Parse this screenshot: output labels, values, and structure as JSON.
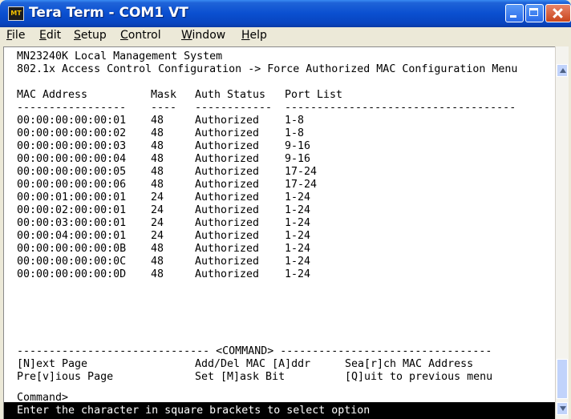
{
  "window": {
    "title": "Tera Term - COM1 VT",
    "app_icon_text": "MT"
  },
  "menu": [
    "File",
    "Edit",
    "Setup",
    "Control",
    "Window",
    "Help"
  ],
  "terminal": {
    "system_title": "MN23240K Local Management System",
    "breadcrumb": "802.1x Access Control Configuration -> Force Authorized MAC Configuration Menu",
    "headers": [
      "MAC Address",
      "Mask",
      "Auth Status",
      "Port List"
    ],
    "header_rules": [
      "-----------------",
      "----",
      "------------",
      "------------------------------------"
    ],
    "rows": [
      [
        "00:00:00:00:00:01",
        "48",
        "Authorized",
        "1-8"
      ],
      [
        "00:00:00:00:00:02",
        "48",
        "Authorized",
        "1-8"
      ],
      [
        "00:00:00:00:00:03",
        "48",
        "Authorized",
        "9-16"
      ],
      [
        "00:00:00:00:00:04",
        "48",
        "Authorized",
        "9-16"
      ],
      [
        "00:00:00:00:00:05",
        "48",
        "Authorized",
        "17-24"
      ],
      [
        "00:00:00:00:00:06",
        "48",
        "Authorized",
        "17-24"
      ],
      [
        "00:00:01:00:00:01",
        "24",
        "Authorized",
        "1-24"
      ],
      [
        "00:00:02:00:00:01",
        "24",
        "Authorized",
        "1-24"
      ],
      [
        "00:00:03:00:00:01",
        "24",
        "Authorized",
        "1-24"
      ],
      [
        "00:00:04:00:00:01",
        "24",
        "Authorized",
        "1-24"
      ],
      [
        "00:00:00:00:00:0B",
        "48",
        "Authorized",
        "1-24"
      ],
      [
        "00:00:00:00:00:0C",
        "48",
        "Authorized",
        "1-24"
      ],
      [
        "00:00:00:00:00:0D",
        "48",
        "Authorized",
        "1-24"
      ]
    ],
    "command_divider": "------------------------------ <COMMAND> ---------------------------------",
    "commands": [
      [
        "[N]ext Page",
        "Add/Del MAC [A]ddr",
        "Sea[r]ch MAC Address"
      ],
      [
        "Pre[v]ious Page",
        "Set [M]ask Bit",
        "[Q]uit to previous menu"
      ]
    ],
    "prompt": "Command>",
    "status": "Enter the character in square brackets to select option"
  },
  "colors": {
    "title_bar": "#0a4fd0",
    "terminal_bg": "#ffffff",
    "terminal_text": "#000000",
    "status_bg": "#000000",
    "status_text": "#ffffff"
  }
}
